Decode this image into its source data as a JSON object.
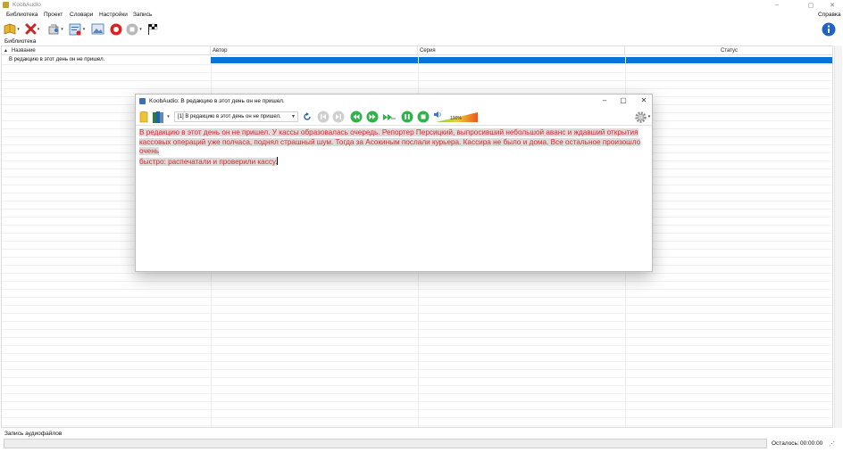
{
  "window": {
    "title": "KoobAudio",
    "controls": [
      "–",
      "▢",
      "✕"
    ]
  },
  "menu": {
    "items": [
      "Библиотека",
      "Проект",
      "Словари",
      "Настройки",
      "Запись"
    ],
    "help": "Справка"
  },
  "library": {
    "label": "Библиотека",
    "columns": [
      "Название",
      "Автор",
      "Серия",
      "Статус"
    ],
    "rows": [
      {
        "title": "В редакцию в этот день он не пришел.",
        "author": "",
        "series": "",
        "status": ""
      }
    ]
  },
  "status": {
    "label": "Запись аудиофайлов",
    "remaining_label": "Осталось:",
    "remaining_value": "00:00:00"
  },
  "child": {
    "title": "KoobAudio: В редакцию в этот день он не пришел.",
    "combo_value": "[1] В редакцию в этот день он не пришел.",
    "volume": "100%",
    "text_lines": [
      "В редакцию в этот день он не пришел. У кассы образовалась очередь. Репортер Персицкий, выпросивший небольшой аванс и ждавший открытия",
      "кассовых операций уже полчаса, поднял страшный шум. Тогда за Асокиным послали курьера. Кассира не было и дома. Все остальное произошло очень",
      "быстро: распечатали и проверили кассу."
    ]
  },
  "colors": {
    "accent": "#0a74d6",
    "text_red": "#e0262a",
    "record": "#e02020",
    "play_green": "#2fb24a"
  },
  "icons": [
    "book-open-icon",
    "x-mark-icon",
    "open-file-icon",
    "settings-check-icon",
    "image-icon",
    "record-icon",
    "stop-icon",
    "checkered-flag-icon",
    "info-icon",
    "folder-icon",
    "books-icon",
    "refresh-icon",
    "skip-back-icon",
    "skip-forward-icon",
    "rewind-icon",
    "fast-forward-icon",
    "speaker-icon",
    "pause-icon",
    "gear-icon"
  ]
}
